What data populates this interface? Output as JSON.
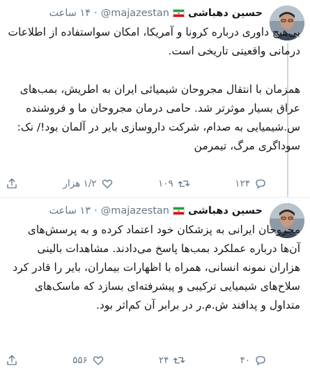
{
  "tweets": [
    {
      "author_name": "حسین دهباشی",
      "handle": "@majazestan",
      "time": "۱۴ ساعت",
      "paragraphs": [
        "بی‌هیچ داوری درباره کرونا و آمریکا، امکان سواستفاده از اطلاعات درمانی واقعیتی تاریخی است.",
        "همزمان با انتقال مجروحان شیمیائی ایران به اطریش، بمب‌های عراق بسیار موثرتر شد. حامی درمان مجروحان ما و فروشنده س.شیمیایی به صدام، شرکت داروسازی بایر در آلمان بود!/ نک: سوداگری مرگ، تیمرمن"
      ],
      "reply_count": "۱۲۴",
      "retweet_count": "۱۰۹",
      "like_count": "۱/۲ هزار"
    },
    {
      "author_name": "حسین دهباشی",
      "handle": "@majazestan",
      "time": "۱۳ ساعت",
      "paragraphs": [
        "مجروحان ایرانی به پزشکان خود اعتماد کرده و به پرسش‌های آن‌ها درباره عملکرد بمب‌ها پاسخ می‌دادند. مشاهدات بالینی هزاران نمونه انسانی، همراه با اظهارات بیماران، بایر را قادر کرد سلاح‌های شیمیایی ترکیبی و پیشرفته‌ای بسازد که ماسک‌های متداول و پدافند ش.م.ر در برابر آن کم‌اثر بود."
      ],
      "reply_count": "۴۰",
      "retweet_count": "۲۴",
      "like_count": "۵۵۶"
    }
  ],
  "colors": {
    "text": "#14171a",
    "secondary": "#657786",
    "divider": "#e6ecf0",
    "thread_line": "#ccd6dd"
  },
  "icons": [
    "reply-icon",
    "retweet-icon",
    "like-icon",
    "share-icon",
    "iran-flag-icon"
  ]
}
